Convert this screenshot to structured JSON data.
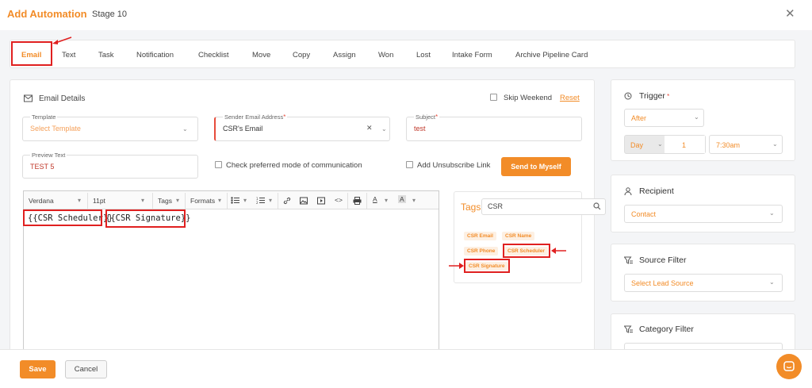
{
  "header": {
    "title": "Add Automation",
    "stage": "Stage 10",
    "close": "✕"
  },
  "tabs": [
    "Email",
    "Text",
    "Task",
    "Notification",
    "Checklist",
    "Move",
    "Copy",
    "Assign",
    "Won",
    "Lost",
    "Intake Form",
    "Archive Pipeline Card"
  ],
  "email": {
    "section_title": "Email Details",
    "skip_weekend": "Skip Weekend",
    "reset": "Reset",
    "template_label": "Template",
    "template_placeholder": "Select Template",
    "sender_label": "Sender Email Address",
    "sender_value": "CSR's Email",
    "subject_label": "Subject",
    "subject_value": "test",
    "preview_label": "Preview Text",
    "preview_value": "TEST 5",
    "preferred_mode": "Check preferred mode of communication",
    "unsubscribe": "Add Unsubscribe Link",
    "send_myself": "Send to Myself"
  },
  "editor": {
    "font": "Verdana",
    "size": "11pt",
    "tags": "Tags",
    "formats": "Formats",
    "content_a": "{{CSR Scheduler}}",
    "content_b": "{{CSR Signature}}"
  },
  "tags_panel": {
    "title": "Tags",
    "search_value": "CSR",
    "items": [
      "CSR Email",
      "CSR Name",
      "CSR Phone",
      "CSR Scheduler",
      "CSR Signature"
    ]
  },
  "trigger": {
    "title": "Trigger",
    "when": "After",
    "unit": "Day",
    "count": "1",
    "time": "7:30am"
  },
  "recipient": {
    "title": "Recipient",
    "value": "Contact"
  },
  "source_filter": {
    "title": "Source Filter",
    "placeholder": "Select Lead Source"
  },
  "category_filter": {
    "title": "Category Filter"
  },
  "footer": {
    "save": "Save",
    "cancel": "Cancel"
  },
  "colors": {
    "accent": "#f28c28",
    "annotation": "#e02020"
  }
}
